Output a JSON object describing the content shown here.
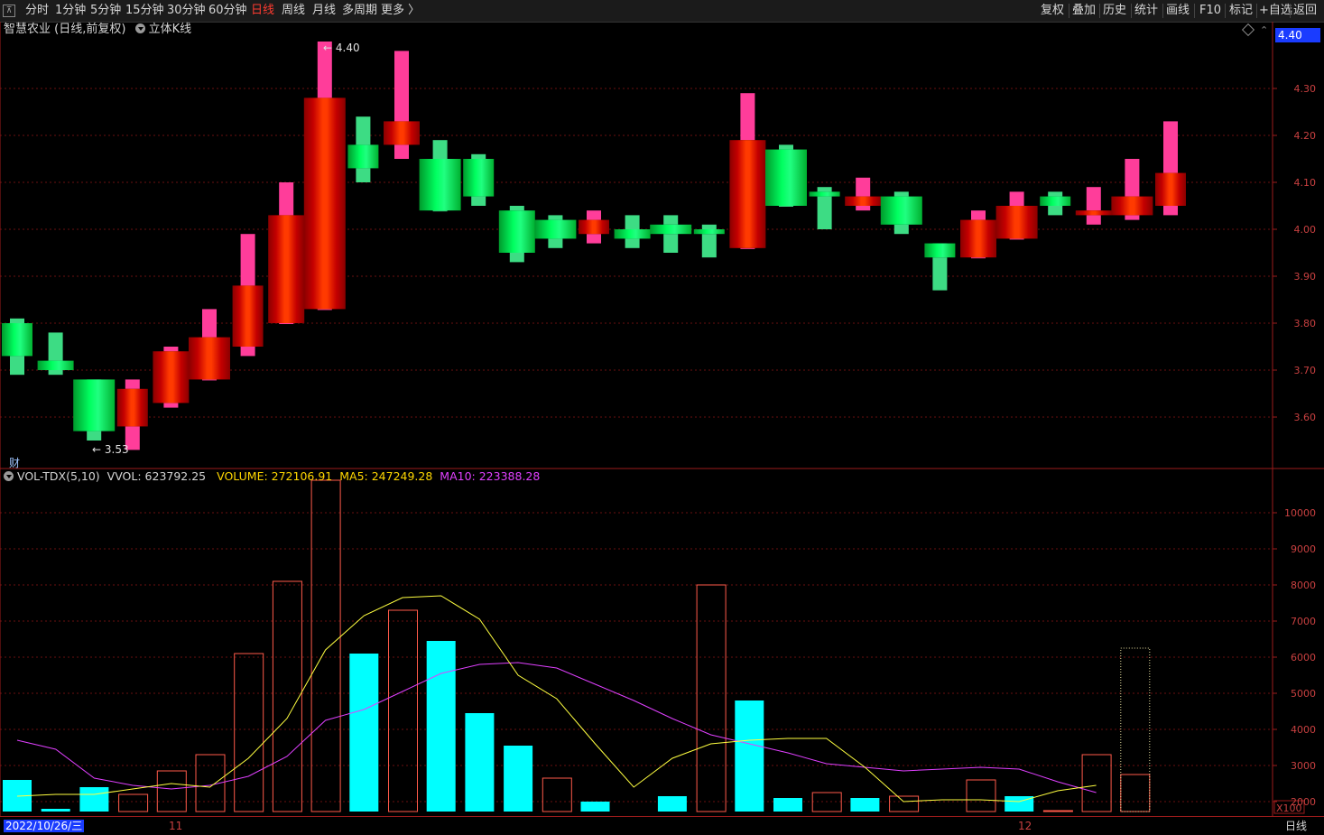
{
  "toolbar": {
    "left_items": [
      "分时",
      "1分钟",
      "5分钟",
      "15分钟",
      "30分钟",
      "60分钟",
      "日线",
      "周线",
      "月线",
      "多周期",
      "更多 〉"
    ],
    "active_item": "日线",
    "right_items": [
      "复权",
      "叠加",
      "历史",
      "统计",
      "画线",
      "F10",
      "标记",
      "+自选",
      "返回"
    ]
  },
  "chart_header": {
    "stock_name": "智慧农业",
    "period_info": "(日线,前复权)",
    "indicator": "立体K线"
  },
  "price_axis": {
    "ticks": [
      "4.30",
      "4.20",
      "4.10",
      "4.00",
      "3.90",
      "3.80",
      "3.70",
      "3.60"
    ],
    "current_price_label": "4.40"
  },
  "annotations": {
    "high": "4.40",
    "low": "3.53"
  },
  "cai_label": "财",
  "volume_header": {
    "name": "VOL-TDX(5,10)",
    "vvol": "VVOL: 623792.25",
    "volume": "VOLUME: 272106.91",
    "ma5": "MA5: 247249.28",
    "ma10": "MA10: 223388.28"
  },
  "volume_axis": {
    "ticks": [
      "10000",
      "9000",
      "8000",
      "7000",
      "6000",
      "5000",
      "4000",
      "3000",
      "2000"
    ],
    "unit": "X100"
  },
  "date_axis": {
    "labels": [
      "2022/10/26/三",
      "11",
      "12"
    ],
    "period_button": "日线"
  },
  "colors": {
    "up": "#ff2020",
    "down": "#00e060",
    "vol_down": "#00ffff",
    "vol_up": "#ff5a4a",
    "ma5": "#ffff40",
    "ma10": "#e040ff",
    "axis": "#9b1b1b"
  },
  "chart_data": [
    {
      "type": "candlestick",
      "title": "智慧农业 (日线,前复权)",
      "ylim": [
        3.55,
        4.45
      ],
      "candles": [
        {
          "o": 3.8,
          "c": 3.73,
          "h": 3.81,
          "l": 3.69
        },
        {
          "o": 3.72,
          "c": 3.7,
          "h": 3.78,
          "l": 3.69
        },
        {
          "o": 3.68,
          "c": 3.57,
          "h": 3.68,
          "l": 3.55
        },
        {
          "o": 3.58,
          "c": 3.66,
          "h": 3.68,
          "l": 3.53
        },
        {
          "o": 3.63,
          "c": 3.74,
          "h": 3.75,
          "l": 3.62
        },
        {
          "o": 3.68,
          "c": 3.77,
          "h": 3.83,
          "l": 3.71
        },
        {
          "o": 3.75,
          "c": 3.88,
          "h": 3.99,
          "l": 3.73
        },
        {
          "o": 3.8,
          "c": 4.03,
          "h": 4.1,
          "l": 3.83
        },
        {
          "o": 3.83,
          "c": 4.28,
          "h": 4.4,
          "l": 3.98
        },
        {
          "o": 4.18,
          "c": 4.13,
          "h": 4.24,
          "l": 4.1
        },
        {
          "o": 4.18,
          "c": 4.23,
          "h": 4.38,
          "l": 4.15
        },
        {
          "o": 4.15,
          "c": 4.04,
          "h": 4.19,
          "l": 4.04
        },
        {
          "o": 4.15,
          "c": 4.07,
          "h": 4.16,
          "l": 4.05
        },
        {
          "o": 4.04,
          "c": 3.95,
          "h": 4.05,
          "l": 3.93
        },
        {
          "o": 4.02,
          "c": 3.98,
          "h": 4.03,
          "l": 3.96
        },
        {
          "o": 3.99,
          "c": 4.02,
          "h": 4.04,
          "l": 3.97
        },
        {
          "o": 4.0,
          "c": 3.98,
          "h": 4.03,
          "l": 3.96
        },
        {
          "o": 4.01,
          "c": 3.99,
          "h": 4.03,
          "l": 3.95
        },
        {
          "o": 4.0,
          "c": 3.99,
          "h": 4.01,
          "l": 3.94
        },
        {
          "o": 3.96,
          "c": 4.19,
          "h": 4.29,
          "l": 3.96
        },
        {
          "o": 4.17,
          "c": 4.05,
          "h": 4.18,
          "l": 4.05
        },
        {
          "o": 4.08,
          "c": 4.07,
          "h": 4.09,
          "l": 4.0
        },
        {
          "o": 4.05,
          "c": 4.07,
          "h": 4.11,
          "l": 4.04
        },
        {
          "o": 4.07,
          "c": 4.01,
          "h": 4.08,
          "l": 3.99
        },
        {
          "o": 3.97,
          "c": 3.94,
          "h": 3.97,
          "l": 3.87
        },
        {
          "o": 3.94,
          "c": 4.02,
          "h": 4.04,
          "l": 3.96
        },
        {
          "o": 3.98,
          "c": 4.05,
          "h": 4.08,
          "l": 3.98
        },
        {
          "o": 4.07,
          "c": 4.05,
          "h": 4.08,
          "l": 4.03
        },
        {
          "o": 4.03,
          "c": 4.04,
          "h": 4.09,
          "l": 4.01
        },
        {
          "o": 4.03,
          "c": 4.07,
          "h": 4.15,
          "l": 4.02
        },
        {
          "o": 4.05,
          "c": 4.12,
          "h": 4.23,
          "l": 4.03
        }
      ]
    },
    {
      "type": "bar",
      "title": "VOL-TDX(5,10)",
      "unit": "X100",
      "ylim": [
        0,
        11000
      ],
      "values": [
        2600,
        1800,
        2400,
        2200,
        2850,
        3300,
        6100,
        8100,
        10900,
        6100,
        7300,
        6450,
        4450,
        3550,
        2650,
        2000,
        1650,
        2150,
        8000,
        4800,
        2100,
        2250,
        2100,
        2150,
        1550,
        2600,
        2150,
        1750,
        3300,
        2750
      ],
      "up": [
        false,
        false,
        false,
        true,
        true,
        true,
        true,
        true,
        true,
        false,
        true,
        false,
        false,
        false,
        true,
        false,
        true,
        false,
        true,
        false,
        false,
        true,
        false,
        true,
        true,
        true,
        false,
        true,
        true,
        true
      ],
      "last_estimate": 6250,
      "ma5": [
        2150,
        2200,
        2200,
        2350,
        2500,
        2400,
        3200,
        4300,
        6200,
        7150,
        7650,
        7700,
        7050,
        5500,
        4850,
        3600,
        2400,
        3200,
        3600,
        3700,
        3750,
        3750,
        2950,
        2000,
        2050,
        2050,
        2000,
        2300,
        2450
      ],
      "ma10": [
        3700,
        3450,
        2650,
        2450,
        2350,
        2450,
        2700,
        3250,
        4250,
        4550,
        5050,
        5550,
        5800,
        5850,
        5700,
        5250,
        4800,
        4300,
        3850,
        3600,
        3350,
        3050,
        2950,
        2850,
        2900,
        2950,
        2900,
        2550,
        2250
      ]
    }
  ]
}
